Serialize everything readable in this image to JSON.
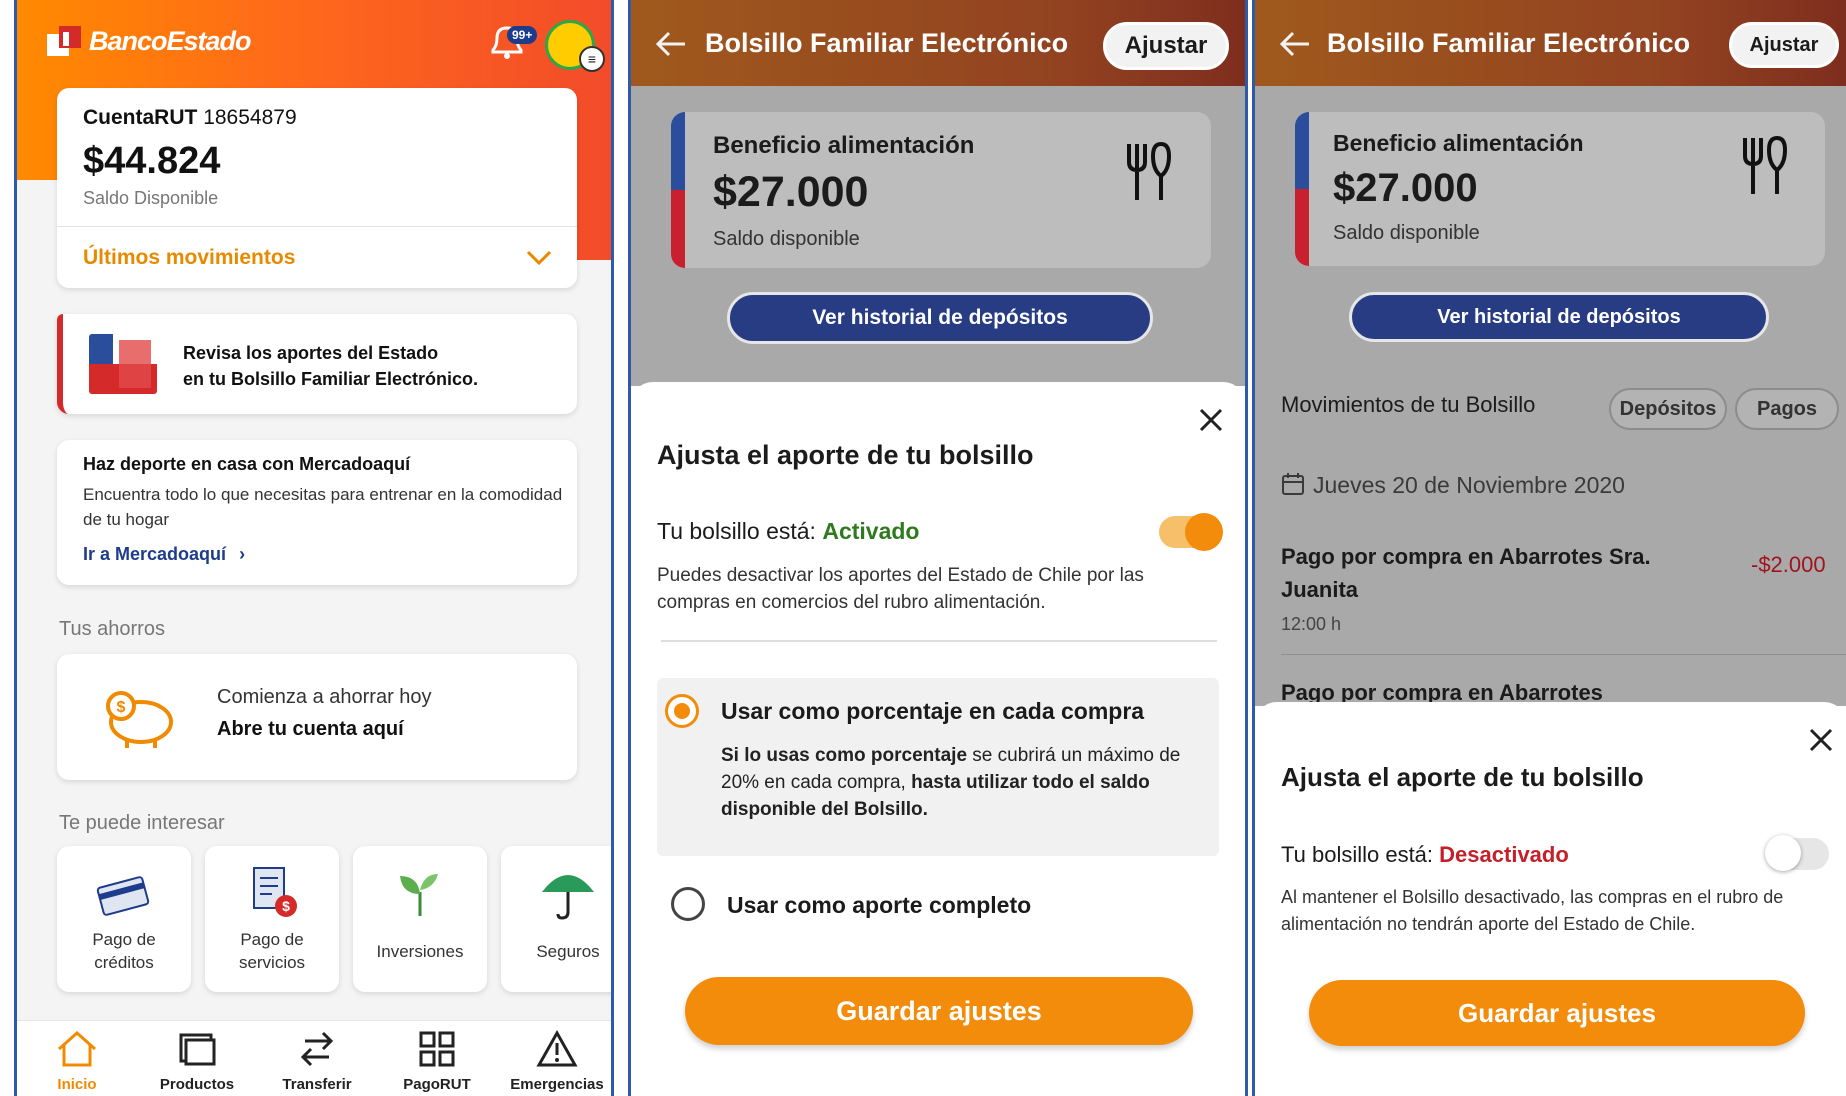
{
  "panel1": {
    "brand": "BancoEstado",
    "notification_badge": "99+",
    "account": {
      "label": "CuentaRUT",
      "number": "18654879",
      "amount": "$44.824",
      "subtitle": "Saldo Disponible",
      "movements_label": "Últimos movimientos"
    },
    "promo": {
      "line1": "Revisa los aportes del Estado",
      "line2": "en tu Bolsillo Familiar Electrónico."
    },
    "mercado": {
      "title": "Haz deporte en casa con Mercadoaquí",
      "description": "Encuentra todo lo que necesitas para entrenar en la comodidad de tu hogar",
      "link": "Ir a Mercadoaquí"
    },
    "savings_section": "Tus ahorros",
    "savings": {
      "line1": "Comienza a ahorrar hoy",
      "line2": "Abre tu cuenta aquí"
    },
    "interest_section": "Te puede interesar",
    "tiles": [
      {
        "label": "Pago de créditos",
        "icon": "card-payment-icon"
      },
      {
        "label": "Pago de servicios",
        "icon": "bill-icon"
      },
      {
        "label": "Inversiones",
        "icon": "plant-icon"
      },
      {
        "label": "Seguros",
        "icon": "umbrella-icon"
      }
    ],
    "nav": [
      {
        "label": "Inicio",
        "icon": "home-icon"
      },
      {
        "label": "Productos",
        "icon": "products-icon"
      },
      {
        "label": "Transferir",
        "icon": "transfer-icon"
      },
      {
        "label": "PagoRUT",
        "icon": "qr-icon"
      },
      {
        "label": "Emergencias",
        "icon": "warning-icon"
      }
    ]
  },
  "panel2": {
    "header_title": "Bolsillo Familiar Electrónico",
    "adjust_label": "Ajustar",
    "card": {
      "title": "Beneficio alimentación",
      "amount": "$27.000",
      "subtitle": "Saldo disponible"
    },
    "history_button": "Ver historial de depósitos",
    "sheet": {
      "title": "Ajusta el aporte de tu bolsillo",
      "status_prefix": "Tu bolsillo está:",
      "status_value": "Activado",
      "toggle_on": true,
      "description": "Puedes desactivar los aportes del Estado de Chile por las compras en comercios del rubro alimentación.",
      "option1": {
        "title": "Usar como porcentaje en cada compra",
        "desc_a": "Si lo usas como porcentaje",
        "desc_b": " se cubrirá un máximo de 20% en cada compra, ",
        "desc_c": "hasta utilizar todo el saldo disponible del Bolsillo.",
        "selected": true
      },
      "option2": {
        "title": "Usar como aporte completo",
        "selected": false
      },
      "save_label": "Guardar ajustes"
    }
  },
  "panel3": {
    "header_title": "Bolsillo Familiar Electrónico",
    "adjust_label": "Ajustar",
    "card": {
      "title": "Beneficio alimentación",
      "amount": "$27.000",
      "subtitle": "Saldo disponible"
    },
    "history_button": "Ver historial de depósitos",
    "movements_title": "Movimientos de tu Bolsillo",
    "chips": [
      "Depósitos",
      "Pagos"
    ],
    "date": "Jueves 20 de Noviembre 2020",
    "transactions": [
      {
        "title": "Pago por compra en Abarrotes Sra. Juanita",
        "amount": "-$2.000",
        "time": "12:00 h"
      },
      {
        "title": "Pago por compra en Abarrotes"
      }
    ],
    "sheet": {
      "title": "Ajusta el aporte de tu bolsillo",
      "status_prefix": "Tu bolsillo está:",
      "status_value": "Desactivado",
      "toggle_on": false,
      "description": "Al mantener el Bolsillo desactivado, las compras en el rubro de alimentación no tendrán aporte del Estado de Chile.",
      "save_label": "Guardar ajustes"
    }
  },
  "colors": {
    "orange": "#f28c0a",
    "navy": "#273c82",
    "active_green": "#2f7a1e",
    "inactive_red": "#c4202a"
  }
}
